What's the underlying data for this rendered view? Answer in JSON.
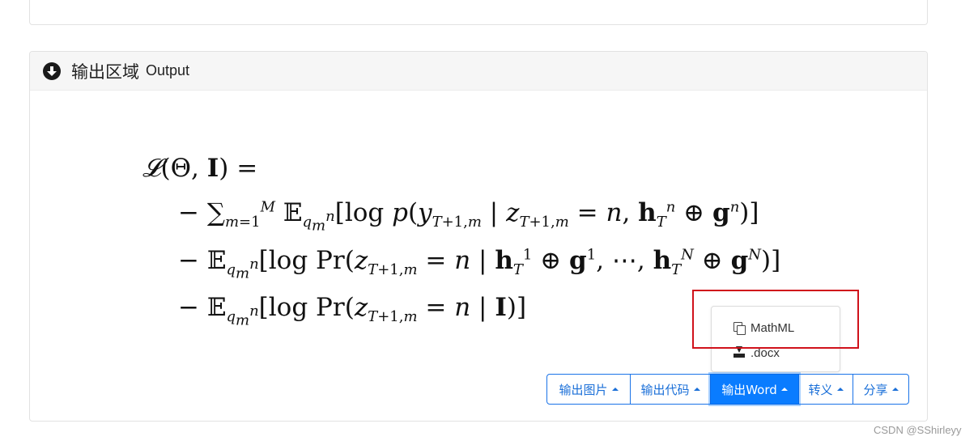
{
  "output_panel": {
    "title": "输出区域",
    "subtitle": "Output"
  },
  "equation": {
    "lines": [
      "𝓛(Θ, 𝐈) =",
      "− ∑_{m=1}^{M} 𝔼_{q_m^n}[log p(y_{T+1,m} | z_{T+1,m} = n, 𝐡_T^n ⊕ 𝐠^n)]",
      "− 𝔼_{q_m^n}[log Pr(z_{T+1,m} = n | 𝐡_T^1 ⊕ 𝐠^1, ⋯, 𝐡_T^N ⊕ 𝐠^N)]",
      "− 𝔼_{q_m^n}[log Pr(z_{T+1,m} = n | 𝐈)]"
    ]
  },
  "dropdown": {
    "items": [
      {
        "label": "MathML",
        "icon": "copy-icon"
      },
      {
        "label": ".docx",
        "icon": "download-icon"
      }
    ]
  },
  "toolbar": {
    "buttons": [
      {
        "label": "输出图片",
        "active": false
      },
      {
        "label": "输出代码",
        "active": false
      },
      {
        "label": "输出Word",
        "active": true
      },
      {
        "label": "转义",
        "active": false
      },
      {
        "label": "分享",
        "active": false
      }
    ]
  },
  "watermark": "CSDN @SShirleyy",
  "colors": {
    "primary": "#0a7cff",
    "highlight_box": "#d0121b",
    "header_bg": "#f6f6f6"
  }
}
